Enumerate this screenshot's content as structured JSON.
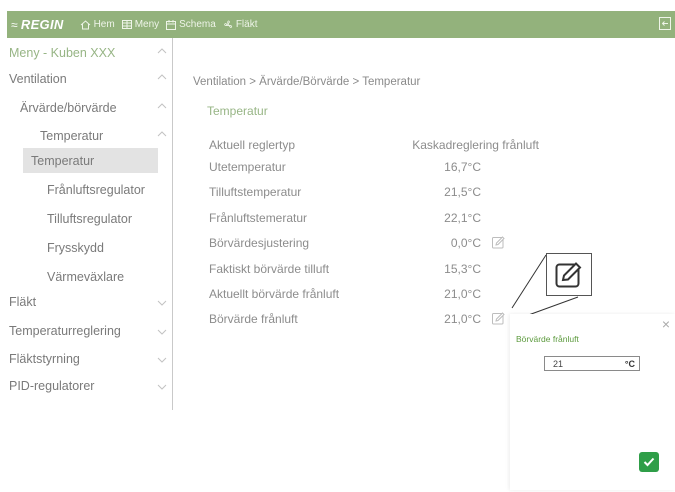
{
  "topbar": {
    "brand": "REGIN",
    "nav": [
      {
        "label": "Hem",
        "icon": "home-icon"
      },
      {
        "label": "Meny",
        "icon": "menu-grid-icon"
      },
      {
        "label": "Schema",
        "icon": "calendar-icon"
      },
      {
        "label": "Fläkt",
        "icon": "fan-icon"
      }
    ],
    "logout_icon": "logout-icon"
  },
  "sidebar": {
    "items": [
      {
        "label": "Meny - Kuben XXX",
        "state": "expanded"
      },
      {
        "label": "Ventilation",
        "state": "expanded"
      },
      {
        "label": "Ärvärde/börvärde",
        "state": "expanded"
      },
      {
        "label": "Temperatur",
        "state": "expanded"
      },
      {
        "label": "Temperatur",
        "state": "selected"
      },
      {
        "label": "Frånluftsregulator",
        "state": "none"
      },
      {
        "label": "Tilluftsregulator",
        "state": "none"
      },
      {
        "label": "Frysskydd",
        "state": "none"
      },
      {
        "label": "Värmeväxlare",
        "state": "none"
      },
      {
        "label": "Fläkt",
        "state": "collapsed"
      },
      {
        "label": "Temperaturreglering",
        "state": "collapsed"
      },
      {
        "label": "Fläktstyrning",
        "state": "collapsed"
      },
      {
        "label": "PID-regulatorer",
        "state": "collapsed"
      }
    ]
  },
  "main": {
    "breadcrumb": "Ventilation > Ärvärde/Börvärde > Temperatur",
    "section_title": "Temperatur",
    "rows": [
      {
        "label": "Aktuell reglertyp",
        "value": "Kaskadreglering frånluft",
        "editable": false
      },
      {
        "label": "Utetemperatur",
        "value": "16,7°C",
        "editable": false
      },
      {
        "label": "Tilluftstemperatur",
        "value": "21,5°C",
        "editable": false
      },
      {
        "label": "Frånluftstemeratur",
        "value": "22,1°C",
        "editable": false
      },
      {
        "label": "Börvärdesjustering",
        "value": "0,0°C",
        "editable": true
      },
      {
        "label": "Faktiskt börvärde tilluft",
        "value": "15,3°C",
        "editable": false
      },
      {
        "label": "Aktuellt börvärde frånluft",
        "value": "21,0°C",
        "editable": false
      },
      {
        "label": "Börvärde frånluft",
        "value": "21,0°C",
        "editable": true
      }
    ]
  },
  "edit_panel": {
    "close": "×",
    "title": "Börvärde frånluft",
    "value": "21",
    "unit": "°C",
    "confirm_icon": "checkmark-icon"
  },
  "colors": {
    "topbar": "#93b27c",
    "accent_green": "#97b585",
    "confirm_green": "#2f9e48",
    "text_gray": "#8c8c8c"
  }
}
